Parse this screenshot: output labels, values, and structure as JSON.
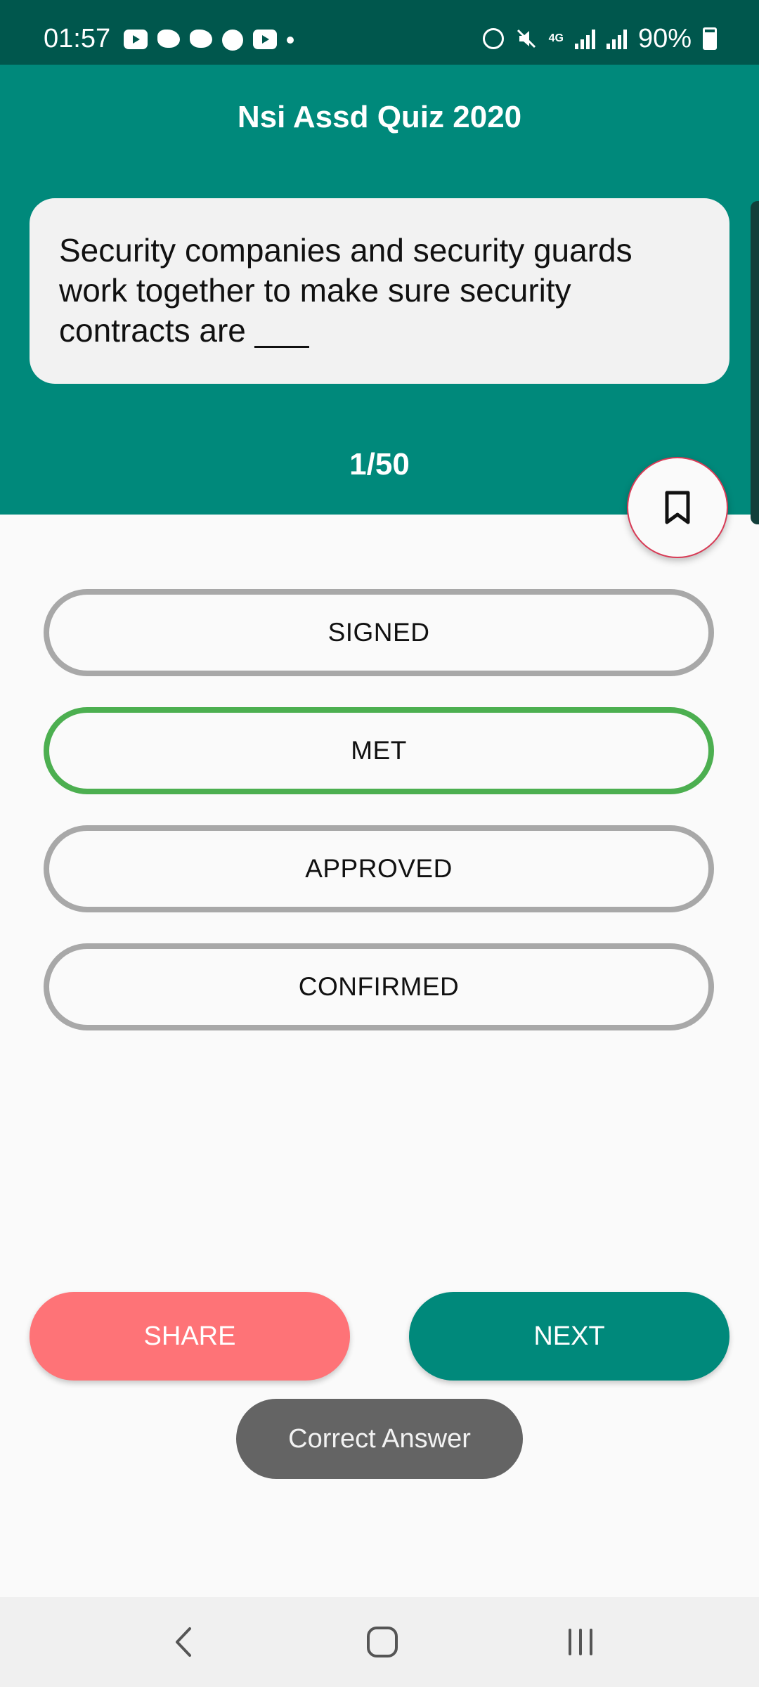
{
  "status_bar": {
    "time": "01:57",
    "battery": "90%",
    "network": "4G",
    "notification_icons": [
      "youtube-icon",
      "accessibility-icon",
      "twitter-icon",
      "chrome-icon",
      "youtube-icon",
      "dot-icon"
    ],
    "system_icons": [
      "alarm-icon",
      "mute-icon",
      "signal-icon",
      "signal-icon",
      "battery-icon"
    ]
  },
  "header": {
    "title": "Nsi Assd Quiz 2020",
    "background_color": "#00897b"
  },
  "question": {
    "text": "Security companies and security guards work together to make sure security contracts are ___"
  },
  "progress": {
    "label": "1/50",
    "current": 1,
    "total": 50
  },
  "bookmark": {
    "icon": "bookmark-icon"
  },
  "options": [
    {
      "label": "SIGNED",
      "state": "default"
    },
    {
      "label": "MET",
      "state": "correct"
    },
    {
      "label": "APPROVED",
      "state": "default"
    },
    {
      "label": "CONFIRMED",
      "state": "default"
    }
  ],
  "actions": {
    "share_label": "SHARE",
    "next_label": "NEXT",
    "share_color": "#fe7377",
    "next_color": "#00897b"
  },
  "toast": {
    "message": "Correct Answer"
  },
  "nav_bar": {
    "icons": [
      "back-icon",
      "home-icon",
      "recents-icon"
    ]
  },
  "colors": {
    "correct_border": "#4caf50",
    "default_border": "#a8a8a8"
  }
}
